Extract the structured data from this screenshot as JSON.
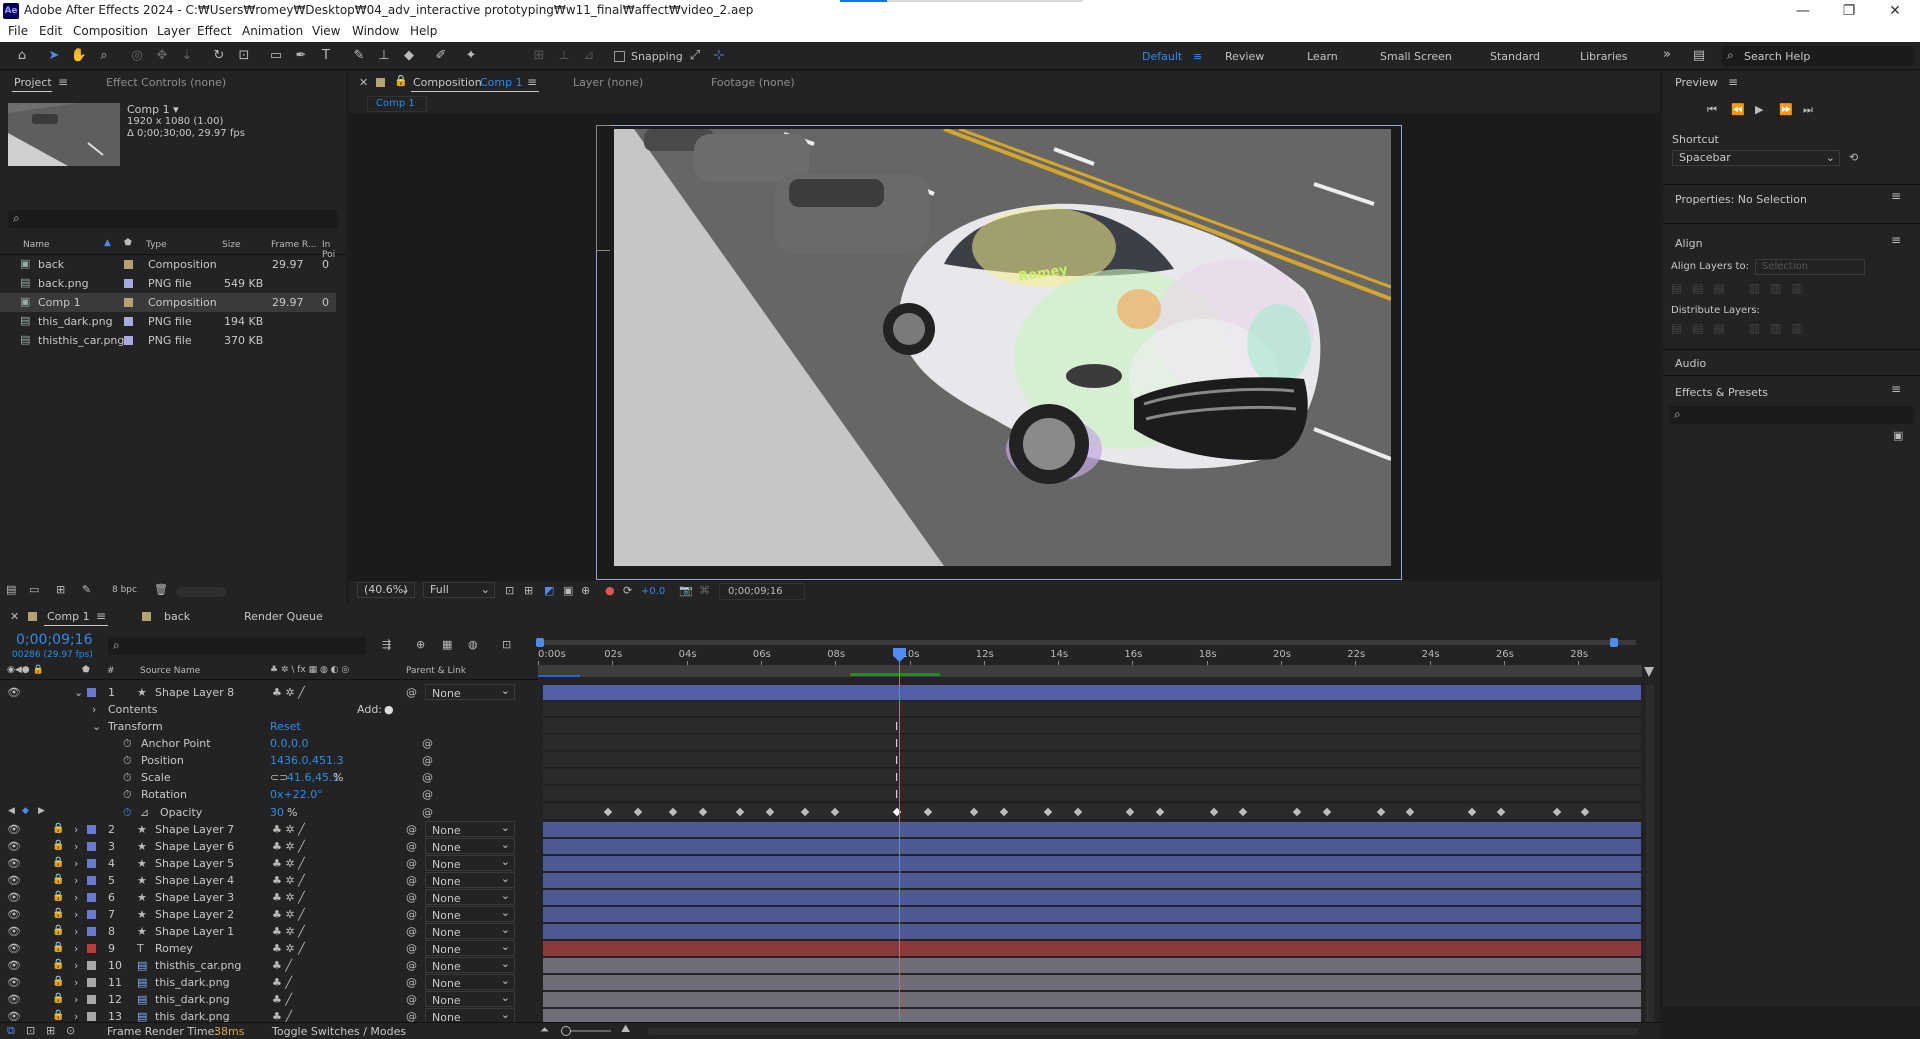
{
  "window": {
    "app_icon": "Ae",
    "title": "Adobe After Effects 2024 - C:₩Users₩romey₩Desktop₩04_adv_interactive prototyping₩w11_final₩affect₩video_2.aep",
    "controls": [
      "minimize-icon",
      "restore-icon",
      "close-icon"
    ]
  },
  "menu": [
    "File",
    "Edit",
    "Composition",
    "Layer",
    "Effect",
    "Animation",
    "View",
    "Window",
    "Help"
  ],
  "toolbar": {
    "snapping_label": "Snapping",
    "workspaces": [
      "Default",
      "Review",
      "Learn",
      "Small Screen",
      "Standard",
      "Libraries"
    ],
    "active_workspace": "Default",
    "search_placeholder": "Search Help"
  },
  "project_panel": {
    "tabs": [
      "Project",
      "Effect Controls (none)"
    ],
    "selected_item": {
      "name": "Comp 1 ▾",
      "resolution": "1920 x 1080 (1.00)",
      "duration": "Δ 0;00;30;00, 29.97 fps"
    },
    "columns": [
      "Name",
      "Type",
      "Size",
      "Frame R...",
      "In Poi"
    ],
    "items": [
      {
        "name": "back",
        "type": "Composition",
        "size": "",
        "fps": "29.97",
        "in": "0",
        "color": "#b5a472"
      },
      {
        "name": "back.png",
        "type": "PNG file",
        "size": "549 KB",
        "fps": "",
        "in": "",
        "color": "#a9a9e0"
      },
      {
        "name": "Comp 1",
        "type": "Composition",
        "size": "",
        "fps": "29.97",
        "in": "0",
        "color": "#b5a472"
      },
      {
        "name": "this_dark.png",
        "type": "PNG file",
        "size": "194 KB",
        "fps": "",
        "in": "",
        "color": "#a9a9e0"
      },
      {
        "name": "thisthis_car.png",
        "type": "PNG file",
        "size": "370 KB",
        "fps": "",
        "in": "",
        "color": "#a9a9e0"
      }
    ],
    "bpc": "8 bpc"
  },
  "composition_panel": {
    "tabs": [
      "Composition",
      "Comp 1",
      "Layer (none)",
      "Footage (none)"
    ],
    "subtab": "Comp 1",
    "zoom": "(40.6%)",
    "resolution": "Full",
    "exposure": "+0.0",
    "timecode": "0;00;09;16",
    "overlay_text": "Romey"
  },
  "right_panel": {
    "preview_title": "Preview",
    "shortcut_label": "Shortcut",
    "shortcut_value": "Spacebar",
    "properties_title": "Properties: No Selection",
    "align_title": "Align",
    "align_layers_to": "Align Layers to:",
    "align_target": "Selection",
    "distribute_label": "Distribute Layers:",
    "audio_title": "Audio",
    "effects_title": "Effects & Presets"
  },
  "timeline": {
    "tabs": [
      "Comp 1",
      "back",
      "Render Queue"
    ],
    "timecode": "0;00;09;16",
    "frame_info": "00286 (29.97 fps)",
    "columns": {
      "num": "#",
      "source": "Source Name",
      "parent": "Parent & Link"
    },
    "ruler": [
      "0:00s",
      "02s",
      "04s",
      "06s",
      "08s",
      "10s",
      "12s",
      "14s",
      "16s",
      "18s",
      "20s",
      "22s",
      "24s",
      "26s",
      "28s"
    ],
    "expanded_layer": {
      "num": "1",
      "name": "Shape Layer 8",
      "parent": "None"
    },
    "contents_label": "Contents",
    "add_label": "Add:",
    "transform_label": "Transform",
    "reset_label": "Reset",
    "properties": [
      {
        "name": "Anchor Point",
        "value": "0.0,0.0",
        "unit": ""
      },
      {
        "name": "Position",
        "value": "1436.0,451.3",
        "unit": ""
      },
      {
        "name": "Scale",
        "value": "41.6,45.1",
        "unit": "%"
      },
      {
        "name": "Rotation",
        "value": "0x+22.0°",
        "unit": ""
      },
      {
        "name": "Opacity",
        "value": "30",
        "unit": "%"
      }
    ],
    "layers": [
      {
        "num": "2",
        "name": "Shape Layer 7",
        "type": "star",
        "color": "#6b79d6",
        "bar": "#4f5a94",
        "parent": "None"
      },
      {
        "num": "3",
        "name": "Shape Layer 6",
        "type": "star",
        "color": "#6b79d6",
        "bar": "#4f5a94",
        "parent": "None"
      },
      {
        "num": "4",
        "name": "Shape Layer 5",
        "type": "star",
        "color": "#6b79d6",
        "bar": "#4f5a94",
        "parent": "None"
      },
      {
        "num": "5",
        "name": "Shape Layer 4",
        "type": "star",
        "color": "#6b79d6",
        "bar": "#4f5a94",
        "parent": "None"
      },
      {
        "num": "6",
        "name": "Shape Layer 3",
        "type": "star",
        "color": "#6b79d6",
        "bar": "#4f5a94",
        "parent": "None"
      },
      {
        "num": "7",
        "name": "Shape Layer 2",
        "type": "star",
        "color": "#6b79d6",
        "bar": "#4f5a94",
        "parent": "None"
      },
      {
        "num": "8",
        "name": "Shape Layer 1",
        "type": "star",
        "color": "#6b79d6",
        "bar": "#4f5a94",
        "parent": "None"
      },
      {
        "num": "9",
        "name": "Romey",
        "type": "T",
        "color": "#c43a3a",
        "bar": "#8a3a3a",
        "parent": "None"
      },
      {
        "num": "10",
        "name": "thisthis_car.png",
        "type": "img",
        "color": "#a8a8a8",
        "bar": "#6e6e78",
        "parent": "None"
      },
      {
        "num": "11",
        "name": "this_dark.png",
        "type": "img",
        "color": "#a8a8a8",
        "bar": "#6e6e78",
        "parent": "None"
      },
      {
        "num": "12",
        "name": "this_dark.png",
        "type": "img",
        "color": "#a8a8a8",
        "bar": "#6e6e78",
        "parent": "None"
      },
      {
        "num": "13",
        "name": "this_dark.png",
        "type": "img",
        "color": "#a8a8a8",
        "bar": "#6e6e78",
        "parent": "None"
      }
    ],
    "footer": {
      "render_label": "Frame Render Time:",
      "render_value": "38ms",
      "toggle_label": "Toggle Switches / Modes"
    }
  },
  "colors": {
    "accent": "#2d8ceb",
    "playhead": "#4d8cf0",
    "work_area": "#00a000"
  }
}
